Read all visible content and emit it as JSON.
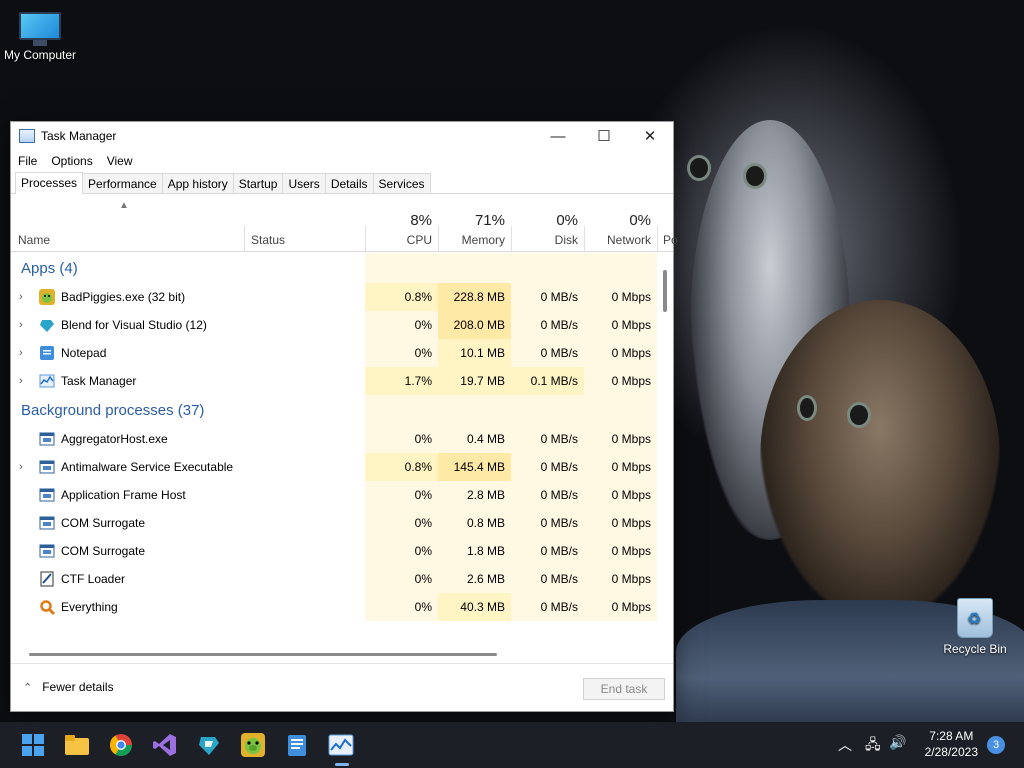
{
  "desktop": {
    "icons": [
      {
        "label": "My Computer"
      },
      {
        "label": "Recycle Bin"
      }
    ]
  },
  "window": {
    "title": "Task Manager",
    "controls": {
      "minimize": "—",
      "maximize": "☐",
      "close": "✕"
    },
    "menu": [
      "File",
      "Options",
      "View"
    ],
    "tabs": [
      "Processes",
      "Performance",
      "App history",
      "Startup",
      "Users",
      "Details",
      "Services"
    ],
    "active_tab": "Processes"
  },
  "columns": {
    "name": "Name",
    "status": "Status",
    "cpu": {
      "label": "CPU",
      "pct": "8%"
    },
    "memory": {
      "label": "Memory",
      "pct": "71%"
    },
    "disk": {
      "label": "Disk",
      "pct": "0%"
    },
    "network": {
      "label": "Network",
      "pct": "0%"
    },
    "power": "Po"
  },
  "groups": [
    {
      "title": "Apps (4)",
      "rows": [
        {
          "name": "BadPiggies.exe (32 bit)",
          "expand": true,
          "icon": "badpiggies-icon",
          "cpu": "0.8%",
          "mem": "228.8 MB",
          "disk": "0 MB/s",
          "net": "0 Mbps"
        },
        {
          "name": "Blend for Visual Studio (12)",
          "expand": true,
          "icon": "blend-icon",
          "cpu": "0%",
          "mem": "208.0 MB",
          "disk": "0 MB/s",
          "net": "0 Mbps"
        },
        {
          "name": "Notepad",
          "expand": true,
          "icon": "notepad-icon",
          "cpu": "0%",
          "mem": "10.1 MB",
          "disk": "0 MB/s",
          "net": "0 Mbps"
        },
        {
          "name": "Task Manager",
          "expand": true,
          "icon": "task-manager-icon",
          "cpu": "1.7%",
          "mem": "19.7 MB",
          "disk": "0.1 MB/s",
          "net": "0 Mbps"
        }
      ]
    },
    {
      "title": "Background processes (37)",
      "rows": [
        {
          "name": "AggregatorHost.exe",
          "expand": false,
          "icon": "process-icon",
          "cpu": "0%",
          "mem": "0.4 MB",
          "disk": "0 MB/s",
          "net": "0 Mbps"
        },
        {
          "name": "Antimalware Service Executable",
          "expand": true,
          "icon": "process-icon",
          "cpu": "0.8%",
          "mem": "145.4 MB",
          "disk": "0 MB/s",
          "net": "0 Mbps"
        },
        {
          "name": "Application Frame Host",
          "expand": false,
          "icon": "process-icon",
          "cpu": "0%",
          "mem": "2.8 MB",
          "disk": "0 MB/s",
          "net": "0 Mbps"
        },
        {
          "name": "COM Surrogate",
          "expand": false,
          "icon": "process-icon",
          "cpu": "0%",
          "mem": "0.8 MB",
          "disk": "0 MB/s",
          "net": "0 Mbps"
        },
        {
          "name": "COM Surrogate",
          "expand": false,
          "icon": "process-icon",
          "cpu": "0%",
          "mem": "1.8 MB",
          "disk": "0 MB/s",
          "net": "0 Mbps"
        },
        {
          "name": "CTF Loader",
          "expand": false,
          "icon": "ctf-loader-icon",
          "cpu": "0%",
          "mem": "2.6 MB",
          "disk": "0 MB/s",
          "net": "0 Mbps"
        },
        {
          "name": "Everything",
          "expand": false,
          "icon": "everything-search-icon",
          "cpu": "0%",
          "mem": "40.3 MB",
          "disk": "0 MB/s",
          "net": "0 Mbps"
        }
      ]
    }
  ],
  "footer": {
    "fewer_details": "Fewer details",
    "end_task": "End task"
  },
  "taskbar": {
    "apps": [
      "start-icon",
      "file-explorer-icon",
      "chrome-icon",
      "visual-studio-icon",
      "blend-icon",
      "badpiggies-icon",
      "notepad-icon",
      "task-manager-icon"
    ],
    "clock_time": "7:28 AM",
    "clock_date": "2/28/2023",
    "notification_count": "3"
  }
}
